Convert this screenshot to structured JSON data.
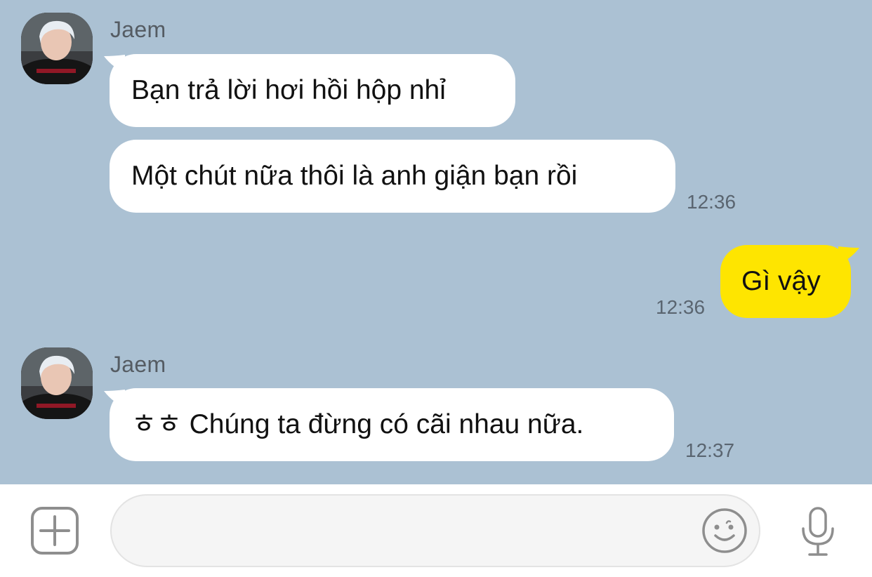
{
  "messages": [
    {
      "sender": "Jaem",
      "text": "Bạn trả lời hơi hồi hộp nhỉ"
    },
    {
      "text": "Một chút nữa thôi là anh giận bạn rồi",
      "time": "12:36"
    },
    {
      "text": "Gì vậy",
      "time": "12:36"
    },
    {
      "sender": "Jaem",
      "text": "ㅎㅎ Chúng ta đừng có cãi nhau nữa.",
      "time": "12:37"
    }
  ],
  "input_bar": {
    "placeholder": "",
    "icons": [
      "plus-icon",
      "emoji-icon",
      "microphone-icon"
    ]
  },
  "colors": {
    "chat_background": "#ABC1D3",
    "incoming_bubble": "#FFFFFF",
    "outgoing_bubble": "#FEE500",
    "input_bar": "#FFFFFF"
  }
}
